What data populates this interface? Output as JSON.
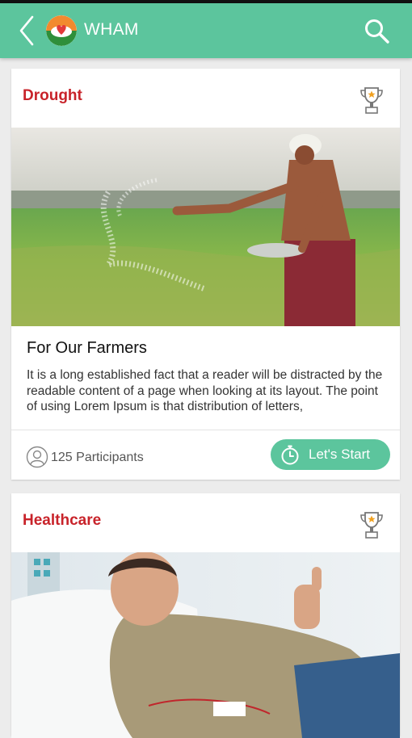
{
  "app": {
    "title": "WHAM",
    "back_icon": "chevron-left-icon",
    "logo_icon": "heart-hands-logo",
    "search_icon": "search-icon",
    "bar_color": "#5cc59d"
  },
  "cards": [
    {
      "category": "Drought",
      "trophy_icon": "trophy-icon",
      "image": "farmer sowing seeds in a green field",
      "headline": "For Our Farmers",
      "description": "It is a long established fact that a reader will be distracted by the readable content of a page when looking at its layout. The point of using Lorem Ipsum is that distribution of letters,",
      "participants": "125 Participants",
      "button": "Let's Start"
    },
    {
      "category": "Healthcare",
      "trophy_icon": "trophy-icon",
      "image": "smiling man donating blood giving thumbs up"
    }
  ],
  "colors": {
    "category_title": "#c8232a",
    "accent": "#5cc59d",
    "background": "#ececec"
  }
}
